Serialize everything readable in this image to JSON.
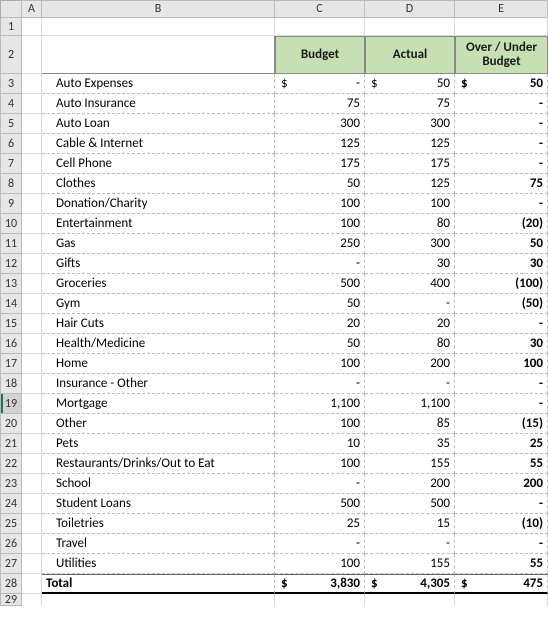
{
  "columns": [
    "A",
    "B",
    "C",
    "D",
    "E"
  ],
  "row_numbers": [
    "1",
    "2",
    "3",
    "4",
    "5",
    "6",
    "7",
    "8",
    "9",
    "10",
    "11",
    "12",
    "13",
    "14",
    "15",
    "16",
    "17",
    "18",
    "19",
    "20",
    "21",
    "22",
    "23",
    "24",
    "25",
    "26",
    "27",
    "28",
    "29"
  ],
  "headers": {
    "budget": "Budget",
    "actual": "Actual",
    "overunder": "Over / Under Budget"
  },
  "categories": [
    {
      "name": "Auto Expenses",
      "budget_sym": "$",
      "budget": "-",
      "actual_sym": "$",
      "actual": "50",
      "diff_sym": "$",
      "diff": "50"
    },
    {
      "name": "Auto Insurance",
      "budget": "75",
      "actual": "75",
      "diff": "-"
    },
    {
      "name": "Auto Loan",
      "budget": "300",
      "actual": "300",
      "diff": "-"
    },
    {
      "name": "Cable & Internet",
      "budget": "125",
      "actual": "125",
      "diff": "-"
    },
    {
      "name": "Cell Phone",
      "budget": "175",
      "actual": "175",
      "diff": "-"
    },
    {
      "name": "Clothes",
      "budget": "50",
      "actual": "125",
      "diff": "75"
    },
    {
      "name": "Donation/Charity",
      "budget": "100",
      "actual": "100",
      "diff": "-"
    },
    {
      "name": "Entertainment",
      "budget": "100",
      "actual": "80",
      "diff": "(20)"
    },
    {
      "name": "Gas",
      "budget": "250",
      "actual": "300",
      "diff": "50"
    },
    {
      "name": "Gifts",
      "budget": "-",
      "actual": "30",
      "diff": "30"
    },
    {
      "name": "Groceries",
      "budget": "500",
      "actual": "400",
      "diff": "(100)"
    },
    {
      "name": "Gym",
      "budget": "50",
      "actual": "-",
      "diff": "(50)"
    },
    {
      "name": "Hair Cuts",
      "budget": "20",
      "actual": "20",
      "diff": "-"
    },
    {
      "name": "Health/Medicine",
      "budget": "50",
      "actual": "80",
      "diff": "30"
    },
    {
      "name": "Home",
      "budget": "100",
      "actual": "200",
      "diff": "100"
    },
    {
      "name": "Insurance - Other",
      "budget": "-",
      "actual": "-",
      "diff": "-"
    },
    {
      "name": "Mortgage",
      "budget": "1,100",
      "actual": "1,100",
      "diff": "-"
    },
    {
      "name": "Other",
      "budget": "100",
      "actual": "85",
      "diff": "(15)"
    },
    {
      "name": "Pets",
      "budget": "10",
      "actual": "35",
      "diff": "25"
    },
    {
      "name": "Restaurants/Drinks/Out to Eat",
      "budget": "100",
      "actual": "155",
      "diff": "55"
    },
    {
      "name": "School",
      "budget": "-",
      "actual": "200",
      "diff": "200"
    },
    {
      "name": "Student Loans",
      "budget": "500",
      "actual": "500",
      "diff": "-"
    },
    {
      "name": "Toiletries",
      "budget": "25",
      "actual": "15",
      "diff": "(10)"
    },
    {
      "name": "Travel",
      "budget": "-",
      "actual": "-",
      "diff": "-"
    },
    {
      "name": "Utilities",
      "budget": "100",
      "actual": "155",
      "diff": "55"
    }
  ],
  "total": {
    "label": "Total",
    "budget_sym": "$",
    "budget": "3,830",
    "actual_sym": "$",
    "actual": "4,305",
    "diff_sym": "$",
    "diff": "475"
  },
  "selected_row": 19
}
